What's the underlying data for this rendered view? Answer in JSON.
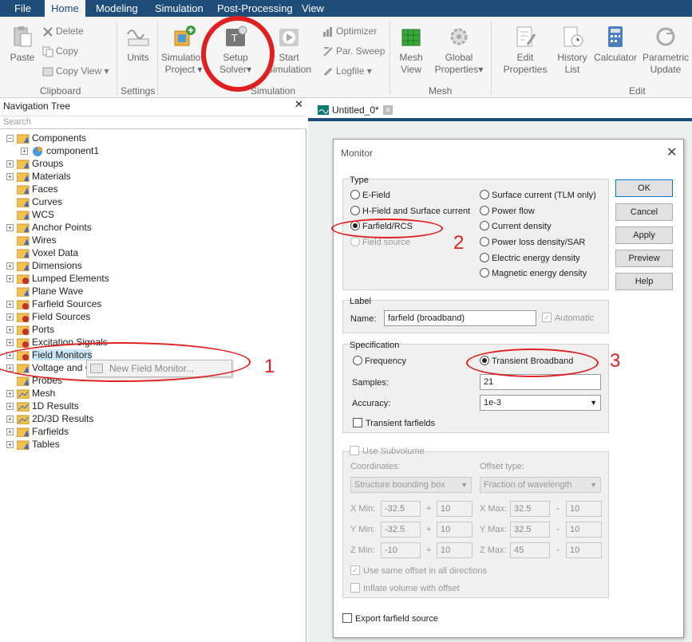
{
  "menubar": {
    "items": [
      "File",
      "Home",
      "Modeling",
      "Simulation",
      "Post-Processing",
      "View"
    ]
  },
  "ribbon": {
    "clipboard": {
      "paste": "Paste",
      "delete": "Delete",
      "copy": "Copy",
      "copy_view": "Copy View",
      "group": "Clipboard"
    },
    "settings": {
      "units": "Units",
      "group": "Settings"
    },
    "simulation": {
      "sim_project_1": "Simulation",
      "sim_project_2": "Project",
      "setup_1": "Setup",
      "setup_2": "Solver",
      "start_1": "Start",
      "start_2": "Simulation",
      "optimizer": "Optimizer",
      "par_sweep": "Par. Sweep",
      "logfile": "Logfile",
      "group": "Simulation"
    },
    "mesh": {
      "mesh_view_1": "Mesh",
      "mesh_view_2": "View",
      "global_1": "Global",
      "global_2": "Properties",
      "group": "Mesh"
    },
    "edit": {
      "edit_props_1": "Edit",
      "edit_props_2": "Properties",
      "history_1": "History",
      "history_2": "List",
      "calculator": "Calculator",
      "param_1": "Parametric",
      "param_2": "Update",
      "group": "Edit"
    }
  },
  "nav": {
    "title": "Navigation Tree",
    "search_placeholder": "Search",
    "items": [
      "Components",
      "component1",
      "Groups",
      "Materials",
      "Faces",
      "Curves",
      "WCS",
      "Anchor Points",
      "Wires",
      "Voxel Data",
      "Dimensions",
      "Lumped Elements",
      "Plane Wave",
      "Farfield Sources",
      "Field Sources",
      "Ports",
      "Excitation Signals",
      "Field Monitors",
      "Voltage and C",
      "Probes",
      "Mesh",
      "1D Results",
      "2D/3D Results",
      "Farfields",
      "Tables"
    ],
    "context_menu": "New Field Monitor..."
  },
  "doc_tab": "Untitled_0*",
  "annotations": [
    "1",
    "2",
    "3"
  ],
  "dialog": {
    "title": "Monitor",
    "type_label": "Type",
    "types_left": [
      "E-Field",
      "H-Field and Surface current",
      "Farfield/RCS",
      "Field source"
    ],
    "types_right": [
      "Surface current (TLM only)",
      "Power flow",
      "Current density",
      "Power loss density/SAR",
      "Electric energy density",
      "Magnetic energy density"
    ],
    "buttons": [
      "OK",
      "Cancel",
      "Apply",
      "Preview",
      "Help"
    ],
    "label_section": "Label",
    "name_label": "Name:",
    "name_value": "farfield (broadband)",
    "automatic": "Automatic",
    "spec_label": "Specification",
    "frequency": "Frequency",
    "transient": "Transient Broadband",
    "samples_label": "Samples:",
    "samples_value": "21",
    "accuracy_label": "Accuracy:",
    "accuracy_value": "1e-3",
    "transient_farfields": "Transient farfields",
    "use_subvolume": "Use Subvolume",
    "coordinates": "Coordinates:",
    "coord_value": "Structure bounding box",
    "offset_type": "Offset type:",
    "offset_value": "Fraction of wavelength",
    "xmin": "X Min:",
    "xmin_v": "-32.5",
    "xmin_o": "10",
    "xmax": "X Max:",
    "xmax_v": "32.5",
    "xmax_o": "10",
    "ymin": "Y Min:",
    "ymin_v": "-32.5",
    "ymin_o": "10",
    "ymax": "Y Max:",
    "ymax_v": "32.5",
    "ymax_o": "10",
    "zmin": "Z Min:",
    "zmin_v": "-10",
    "zmin_o": "10",
    "zmax": "Z Max:",
    "zmax_v": "45",
    "zmax_o": "10",
    "plus": "+",
    "minus": "-",
    "same_offset": "Use same offset in all directions",
    "inflate": "Inflate volume with offset",
    "export": "Export farfield source"
  }
}
